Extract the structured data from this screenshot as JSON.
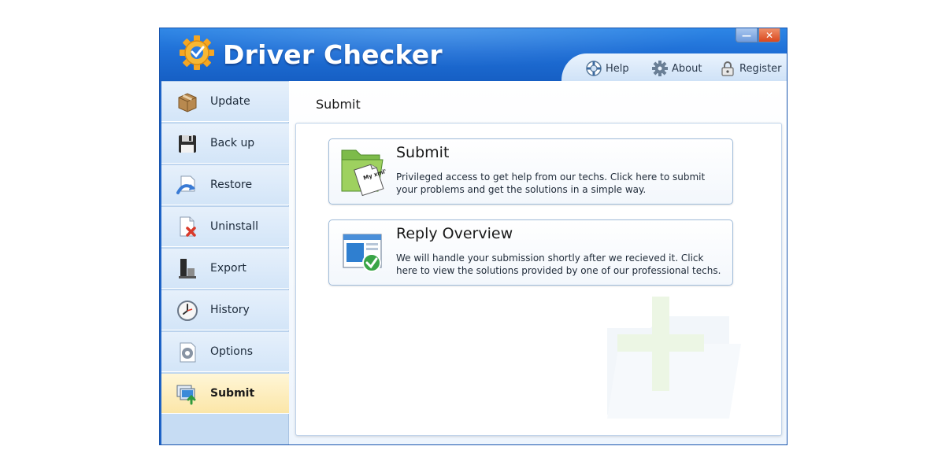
{
  "app": {
    "title": "Driver Checker",
    "window_controls": {
      "minimize": "—",
      "close": "✕"
    }
  },
  "topnav": {
    "items": [
      {
        "label": "Help",
        "icon": "lifebuoy-icon"
      },
      {
        "label": "About",
        "icon": "gear-icon"
      },
      {
        "label": "Register",
        "icon": "lock-icon"
      }
    ]
  },
  "sidebar": {
    "items": [
      {
        "label": "Update",
        "icon": "package-icon",
        "active": false
      },
      {
        "label": "Back up",
        "icon": "floppy-disk-icon",
        "active": false
      },
      {
        "label": "Restore",
        "icon": "restore-icon",
        "active": false
      },
      {
        "label": "Uninstall",
        "icon": "uninstall-icon",
        "active": false
      },
      {
        "label": "Export",
        "icon": "export-icon",
        "active": false
      },
      {
        "label": "History",
        "icon": "clock-icon",
        "active": false
      },
      {
        "label": "Options",
        "icon": "options-icon",
        "active": false
      },
      {
        "label": "Submit",
        "icon": "submit-icon",
        "active": true
      }
    ]
  },
  "main": {
    "title": "Submit",
    "cards": [
      {
        "title": "Submit",
        "description": "Privileged access to get help from our techs. Click here to submit your problems and get the solutions in a simple way.",
        "icon": "folder-document-icon",
        "icon_text": "My xml's"
      },
      {
        "title": "Reply Overview",
        "description": "We will handle your submission shortly after we recieved it. Click here to view the solutions provided by one of our professional techs.",
        "icon": "window-check-icon"
      }
    ]
  },
  "colors": {
    "titlebar": "#1f6fd6",
    "sidebar": "#d3e5f8",
    "active_item": "#fbe6a8",
    "card_border": "#9fbbd9",
    "close_button": "#d9481e"
  }
}
